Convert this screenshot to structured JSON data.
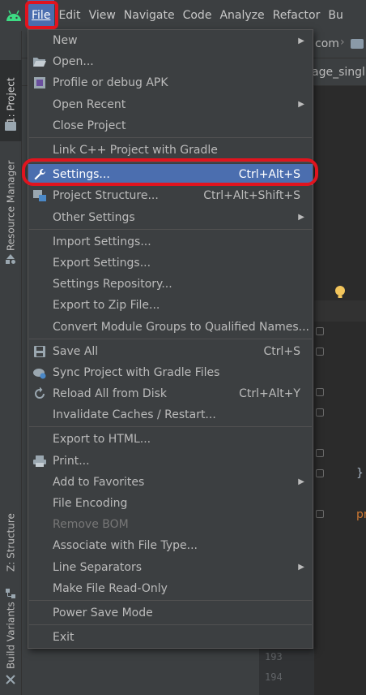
{
  "menubar": {
    "items": [
      "File",
      "Edit",
      "View",
      "Navigate",
      "Code",
      "Analyze",
      "Refactor",
      "Bu"
    ]
  },
  "breadcrumb": {
    "fragment": "com"
  },
  "editor_tab": {
    "fragment": "age_singl"
  },
  "left_strip": {
    "tabs": [
      "1: Project",
      "Resource Manager",
      "Z: Structure",
      "Build Variants"
    ]
  },
  "gutter": {
    "line_numbers": [
      "193",
      "194"
    ]
  },
  "editor": {
    "brace": "}",
    "keyword_fragment": "pr"
  },
  "file_menu": {
    "groups": [
      [
        {
          "label": "New",
          "icon": "",
          "submenu": true
        },
        {
          "label": "Open...",
          "icon": "folder-open-icon"
        },
        {
          "label": "Profile or debug APK",
          "icon": "apk-icon"
        },
        {
          "label": "Open Recent",
          "icon": "",
          "submenu": true
        },
        {
          "label": "Close Project",
          "icon": ""
        }
      ],
      [
        {
          "label": "Link C++ Project with Gradle",
          "icon": ""
        }
      ],
      [
        {
          "label": "Settings...",
          "icon": "wrench-icon",
          "shortcut": "Ctrl+Alt+S",
          "selected": true
        },
        {
          "label": "Project Structure...",
          "icon": "project-structure-icon",
          "shortcut": "Ctrl+Alt+Shift+S"
        },
        {
          "label": "Other Settings",
          "icon": "",
          "submenu": true
        }
      ],
      [
        {
          "label": "Import Settings...",
          "icon": ""
        },
        {
          "label": "Export Settings...",
          "icon": ""
        },
        {
          "label": "Settings Repository...",
          "icon": ""
        },
        {
          "label": "Export to Zip File...",
          "icon": ""
        },
        {
          "label": "Convert Module Groups to Qualified Names...",
          "icon": ""
        }
      ],
      [
        {
          "label": "Save All",
          "icon": "save-icon",
          "shortcut": "Ctrl+S"
        },
        {
          "label": "Sync Project with Gradle Files",
          "icon": "gradle-sync-icon"
        },
        {
          "label": "Reload All from Disk",
          "icon": "reload-icon",
          "shortcut": "Ctrl+Alt+Y"
        },
        {
          "label": "Invalidate Caches / Restart...",
          "icon": ""
        }
      ],
      [
        {
          "label": "Export to HTML...",
          "icon": ""
        },
        {
          "label": "Print...",
          "icon": "printer-icon"
        },
        {
          "label": "Add to Favorites",
          "icon": "",
          "submenu": true
        },
        {
          "label": "File Encoding",
          "icon": ""
        },
        {
          "label": "Remove BOM",
          "icon": "",
          "disabled": true
        },
        {
          "label": "Associate with File Type...",
          "icon": ""
        },
        {
          "label": "Line Separators",
          "icon": "",
          "submenu": true
        },
        {
          "label": "Make File Read-Only",
          "icon": ""
        }
      ],
      [
        {
          "label": "Power Save Mode",
          "icon": ""
        }
      ],
      [
        {
          "label": "Exit",
          "icon": ""
        }
      ]
    ]
  },
  "colors": {
    "menu_bg": "#3c3f41",
    "selection": "#4b6eaf",
    "annotation_red": "#e0141e",
    "text": "#bbbbbb"
  }
}
